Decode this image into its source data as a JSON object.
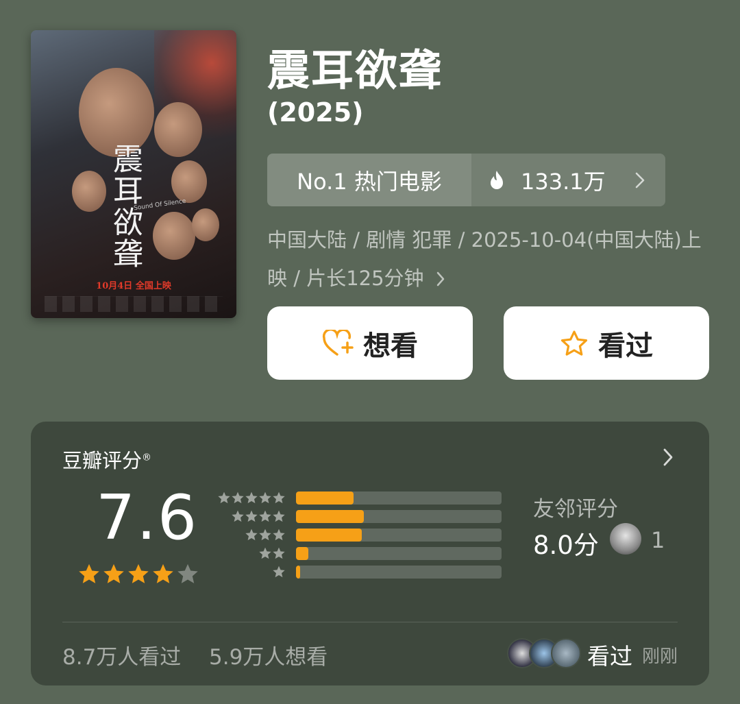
{
  "poster": {
    "title": "震耳欲聋",
    "subtitle": "Sound Of Silence",
    "release_banner": "10月4日 全国上映"
  },
  "movie": {
    "title": "震耳欲聋",
    "year": "(2025)"
  },
  "rank": {
    "label": "No.1 热门电影",
    "heat": "133.1万",
    "icon": "fire-icon"
  },
  "meta": {
    "text": "中国大陆 / 剧情 犯罪 / 2025-10-04(中国大陆)上映 / 片长125分钟"
  },
  "buttons": {
    "want": "想看",
    "seen": "看过"
  },
  "rating": {
    "header": "豆瓣评分",
    "registered_mark": "®",
    "score": "7.6",
    "stars_filled": 4,
    "stars_total": 5,
    "distribution": [
      {
        "stars": 5,
        "fraction": 0.28
      },
      {
        "stars": 4,
        "fraction": 0.33
      },
      {
        "stars": 3,
        "fraction": 0.32
      },
      {
        "stars": 2,
        "fraction": 0.06
      },
      {
        "stars": 1,
        "fraction": 0.02
      }
    ],
    "friends": {
      "label": "友邻评分",
      "score": "8.0分",
      "count": "1"
    },
    "seen_count": "8.7万人看过",
    "want_count": "5.9万人想看",
    "recent_action": "看过",
    "recent_time": "刚刚"
  },
  "colors": {
    "background": "#5a6758",
    "star": "#f6a017",
    "bar_fill": "#f6a017"
  }
}
